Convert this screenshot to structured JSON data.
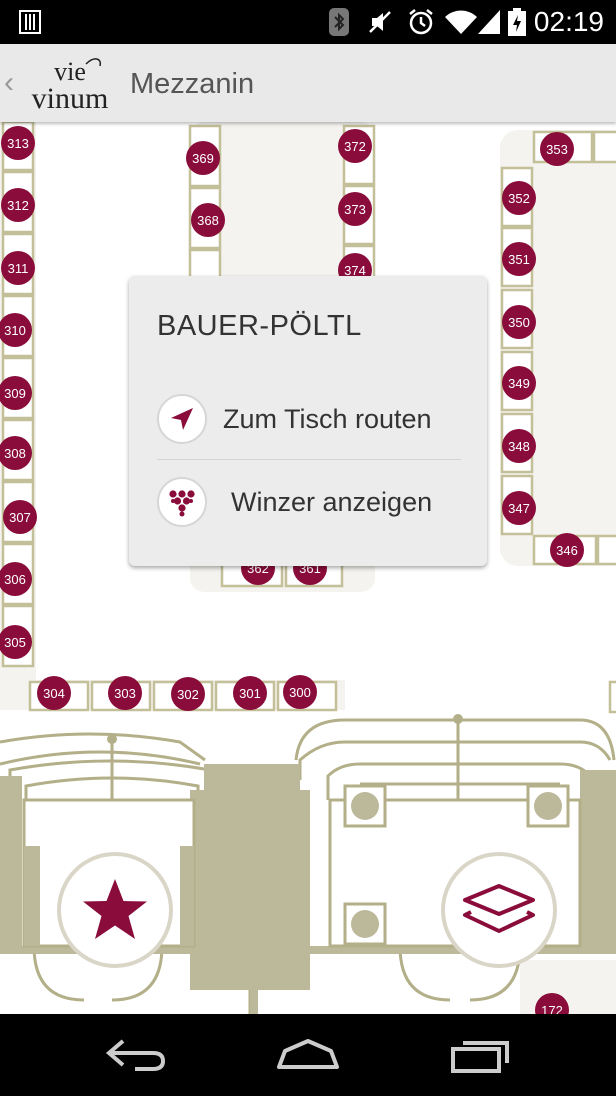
{
  "status_bar": {
    "time": "02:19",
    "icons": [
      "notification-icon",
      "bluetooth-icon",
      "mute-icon",
      "alarm-icon",
      "wifi-icon",
      "signal-icon",
      "battery-icon"
    ]
  },
  "app_bar": {
    "back_icon": "chevron-left-icon",
    "logo_line1": "vie",
    "logo_line2": "vinum",
    "title": "Mezzanin"
  },
  "map": {
    "table_numbers": {
      "left_column": [
        "313",
        "312",
        "311",
        "310",
        "309",
        "308",
        "307",
        "306",
        "305"
      ],
      "bottom_row": [
        "304",
        "303",
        "302",
        "301",
        "300"
      ],
      "center_left": [
        "369",
        "368"
      ],
      "center_right": [
        "372",
        "373",
        "374"
      ],
      "center_bottom": [
        "362",
        "361"
      ],
      "right_column": [
        "353",
        "352",
        "351",
        "350",
        "349",
        "348",
        "347",
        "346"
      ],
      "bottom_right": [
        "172"
      ]
    },
    "colors": {
      "tag": "#8a0c3a",
      "booth_border": "#c3bf98",
      "building": "#bcb89a",
      "lines": "#b3af88"
    }
  },
  "popup": {
    "title": "BAUER-PÖLTL",
    "route_label": "Zum Tisch routen",
    "winzer_label": "Winzer anzeigen",
    "route_icon": "navigation-arrow-icon",
    "winzer_icon": "grape-icon"
  },
  "fabs": {
    "favorites_icon": "star-icon",
    "layers_icon": "layers-icon"
  },
  "nav_bar": {
    "icons": [
      "back-icon",
      "home-icon",
      "recent-apps-icon"
    ]
  }
}
